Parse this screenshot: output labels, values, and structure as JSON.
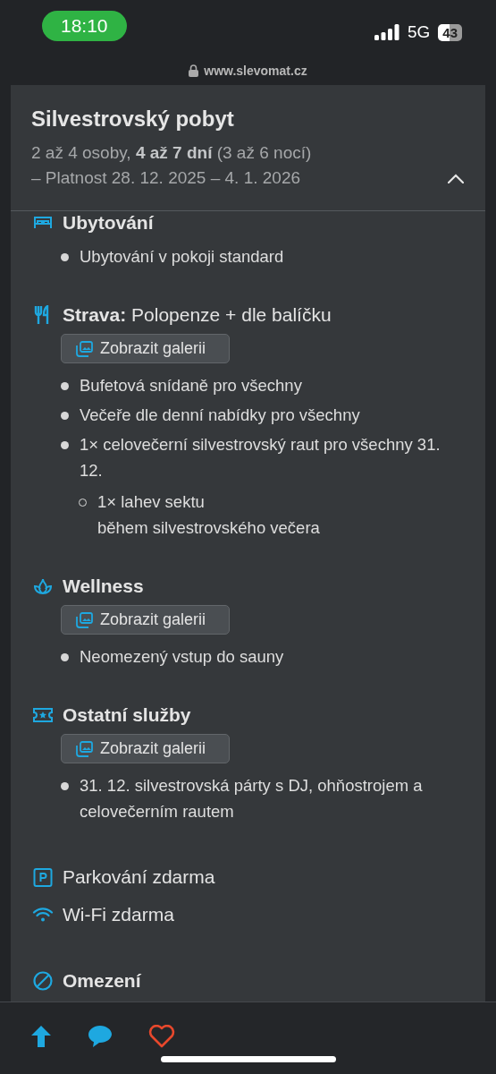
{
  "status_bar": {
    "time": "18:10",
    "network": "5G",
    "battery": "43"
  },
  "address_bar": {
    "url": "www.slevomat.cz"
  },
  "offer": {
    "title": "Silvestrovský pobyt",
    "summary": "2 až 4 osoby, **4 až 7 dní** (3 až 6 nocí)",
    "validity": "– Platnost 28. 12. 2025 – 4. 1. 2026",
    "expanded": true
  },
  "sections": [
    {
      "kind": "bed",
      "heading": "Ubytování",
      "items": [
        {
          "text": "Ubytování v pokoji standard"
        }
      ]
    },
    {
      "kind": "cutlery",
      "heading": "**Strava:** Polopenze + dle balíčku",
      "gallery_button": "Zobrazit galerii",
      "items": [
        {
          "text": "Bufetová snídaně pro všechny"
        },
        {
          "text": "Večeře dle denní nabídky pro všechny"
        },
        {
          "text": "1× celovečerní silvestrovský raut pro všechny 31. 12.",
          "children": [
            {
              "text": "1× lahev sektu\nběhem silvestrovského večera"
            }
          ]
        }
      ]
    },
    {
      "kind": "lotus",
      "heading": "Wellness",
      "gallery_button": "Zobrazit galerii",
      "items": [
        {
          "text": "Neomezený vstup do sauny"
        }
      ]
    },
    {
      "kind": "ticket",
      "heading": "Ostatní služby",
      "gallery_button": "Zobrazit galerii",
      "items": [
        {
          "text": "31. 12. silvestrovská párty s DJ, ohňostrojem a celovečerním rautem"
        }
      ]
    }
  ],
  "amenities": [
    {
      "kind": "parking",
      "label": "Parkování zdarma"
    },
    {
      "kind": "wifi",
      "label": "Wi-Fi zdarma"
    }
  ],
  "restrictions": {
    "heading": "Omezení"
  }
}
